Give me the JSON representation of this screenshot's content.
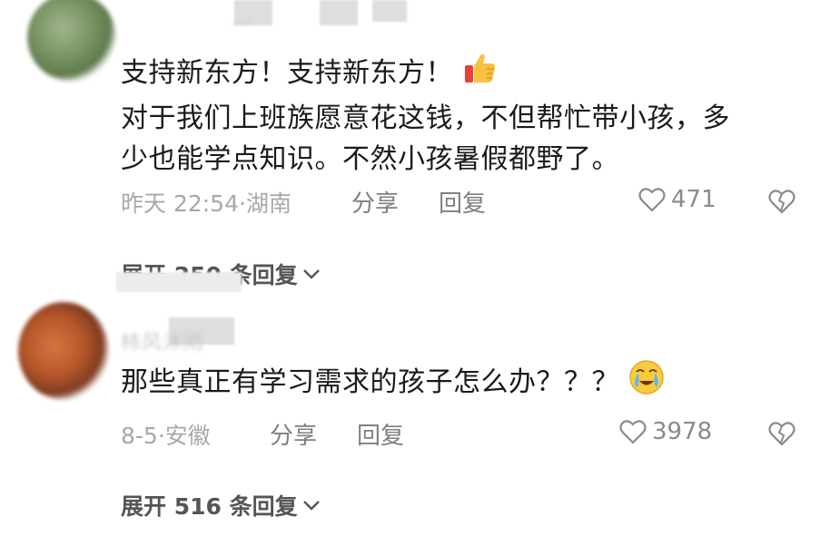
{
  "comments": [
    {
      "username": "...",
      "text_lines": [
        "支持新东方！支持新东方！",
        "对于我们上班族愿意花这钱，不但帮忙带小孩，多",
        "少也能学点知识。不然小孩暑假都野了。"
      ],
      "emoji_icon": "thumbs-up-icon",
      "time": "昨天 22:54",
      "location": "湖南",
      "share_label": "分享",
      "reply_label": "回复",
      "likes": "471",
      "expand_label": "展开 250 条回复"
    },
    {
      "username": "柿风沐雨",
      "text_lines": [
        "那些真正有学习需求的孩子怎么办？？？"
      ],
      "emoji_icon": "crying-face-icon",
      "time": "8-5",
      "location": "安徽",
      "share_label": "分享",
      "reply_label": "回复",
      "likes": "3978",
      "expand_label": "展开 516 条回复"
    }
  ]
}
